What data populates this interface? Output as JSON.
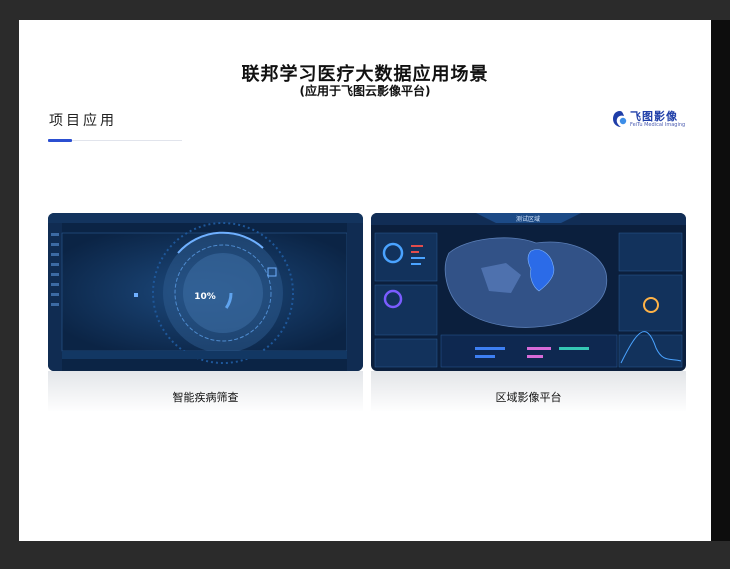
{
  "slide": {
    "title": "联邦学习医疗大数据应用场景",
    "subtitle": "(应用于飞图云影像平台)",
    "section_title": "项目应用"
  },
  "logo": {
    "name": "飞图影像",
    "subtitle": "FeiTu Medical Imaging"
  },
  "cards": [
    {
      "caption": "智能疾病筛查",
      "progress_label": "10%"
    },
    {
      "caption": "区域影像平台",
      "map_title": "测试区域"
    }
  ],
  "colors": {
    "accent": "#2b4fd1",
    "dashboard_bg": "#0b1f3d",
    "map_fill": "#2b6be8"
  }
}
